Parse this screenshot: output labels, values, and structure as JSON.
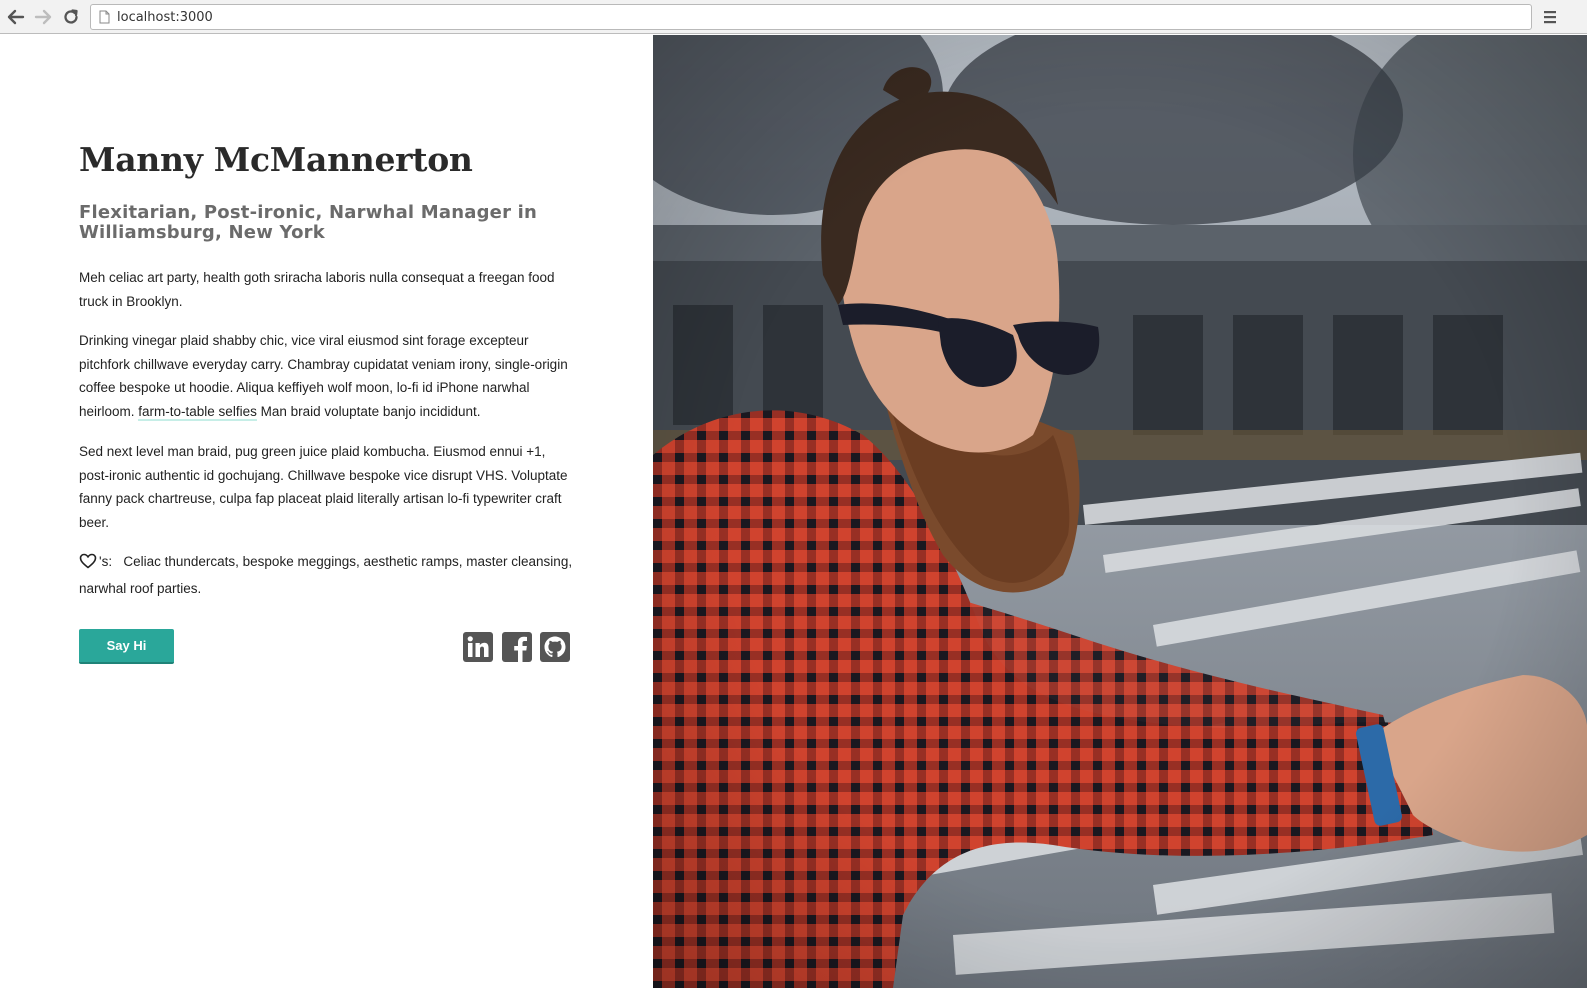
{
  "browser": {
    "url": "localhost:3000"
  },
  "profile": {
    "name": "Manny McMannerton",
    "tagline": "Flexitarian, Post-ironic, Narwhal Manager in Williamsburg, New York",
    "bio_p1": "Meh celiac art party, health goth sriracha laboris nulla consequat a freegan food truck in Brooklyn.",
    "bio_p2_before": "Drinking vinegar plaid shabby chic, vice viral eiusmod sint forage excepteur pitchfork chillwave everyday carry. Chambray cupidatat veniam irony, single-origin coffee bespoke ut hoodie. Aliqua keffiyeh wolf moon, lo-fi id iPhone narwhal heirloom. ",
    "bio_p2_link": "farm-to-table selfies",
    "bio_p2_after": " Man braid voluptate banjo incididunt.",
    "bio_p3": "Sed next level man braid, pug green juice plaid kombucha. Eiusmod ennui +1, post-ironic authentic id gochujang. Chillwave bespoke vice disrupt VHS. Voluptate fanny pack chartreuse, culpa fap placeat plaid literally artisan lo-fi typewriter craft beer.",
    "likes_suffix": "'s:",
    "likes_text": "Celiac thundercats, bespoke meggings, aesthetic ramps, master cleansing, narwhal roof parties."
  },
  "actions": {
    "say_hi_label": "Say Hi"
  },
  "icons": {
    "back": "arrow-left-icon",
    "forward": "arrow-right-icon",
    "reload": "reload-icon",
    "page": "page-icon",
    "menu": "hamburger-menu-icon",
    "heart": "heart-icon",
    "linkedin": "linkedin-icon",
    "facebook": "facebook-icon",
    "github": "github-icon"
  },
  "colors": {
    "accent": "#2aa79a",
    "link_underline": "#c6eee7",
    "social_icon": "#555555"
  }
}
